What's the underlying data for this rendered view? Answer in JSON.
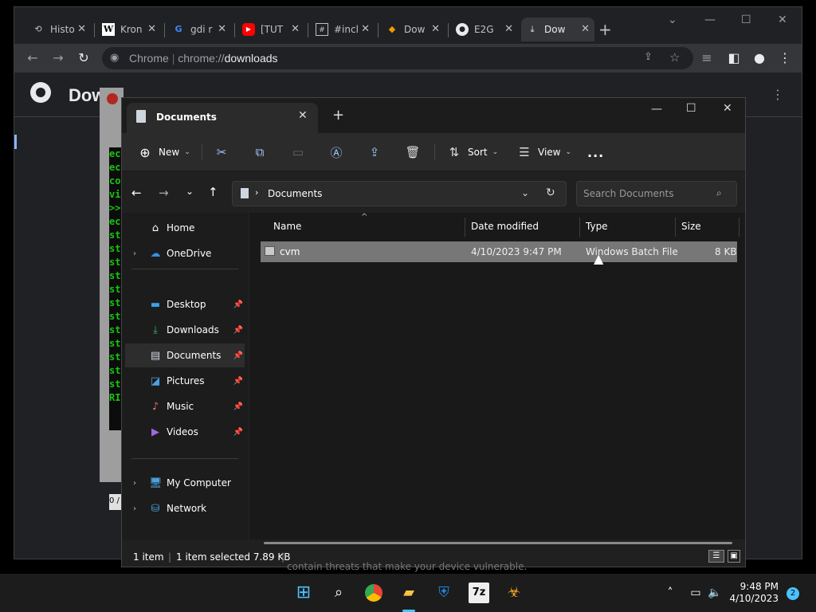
{
  "chrome": {
    "tabs": [
      {
        "label": "Histo",
        "icon": "history-icon"
      },
      {
        "label": "Kron",
        "icon": "wikipedia-icon"
      },
      {
        "label": "gdi r",
        "icon": "google-icon"
      },
      {
        "label": "[TUT",
        "icon": "youtube-icon"
      },
      {
        "label": "#incl",
        "icon": "code-icon"
      },
      {
        "label": "Dow",
        "icon": "diamond-icon"
      },
      {
        "label": "E2G",
        "icon": "github-icon"
      },
      {
        "label": "Dow",
        "icon": "download-icon"
      }
    ],
    "new_tab": "+",
    "omnibox_site": "Chrome",
    "omnibox_scheme": "chrome://",
    "omnibox_path": "downloads",
    "page_title": "Dow",
    "bottom_note": "contain threats that make your device vulnerable."
  },
  "console": {
    "lines": [
      "ec",
      "ec",
      "co",
      "vi",
      ">>",
      "ec",
      "st",
      "st",
      "st",
      "st",
      "st",
      "st",
      "st",
      "st",
      "st",
      "st",
      "st",
      "st",
      "RI"
    ],
    "bottom": "0 /"
  },
  "explorer": {
    "tab_title": "Documents",
    "new_tab": "+",
    "toolbar": {
      "new_label": "New",
      "sort_label": "Sort",
      "view_label": "View",
      "more": "..."
    },
    "address": "Documents",
    "search_placeholder": "Search Documents",
    "nav": {
      "home": "Home",
      "onedrive": "OneDrive",
      "desktop": "Desktop",
      "downloads": "Downloads",
      "documents": "Documents",
      "pictures": "Pictures",
      "music": "Music",
      "videos": "Videos",
      "my_computer": "My Computer",
      "network": "Network"
    },
    "columns": {
      "name": "Name",
      "date": "Date modified",
      "type": "Type",
      "size": "Size"
    },
    "files": [
      {
        "name": "cvm",
        "date": "4/10/2023 9:47 PM",
        "type": "Windows Batch File",
        "size": "8 KB"
      }
    ],
    "status": {
      "count": "1 item",
      "selected": "1 item selected  7.89 KB"
    }
  },
  "taskbar": {
    "time": "9:48 PM",
    "date": "4/10/2023",
    "notifications": "2"
  }
}
